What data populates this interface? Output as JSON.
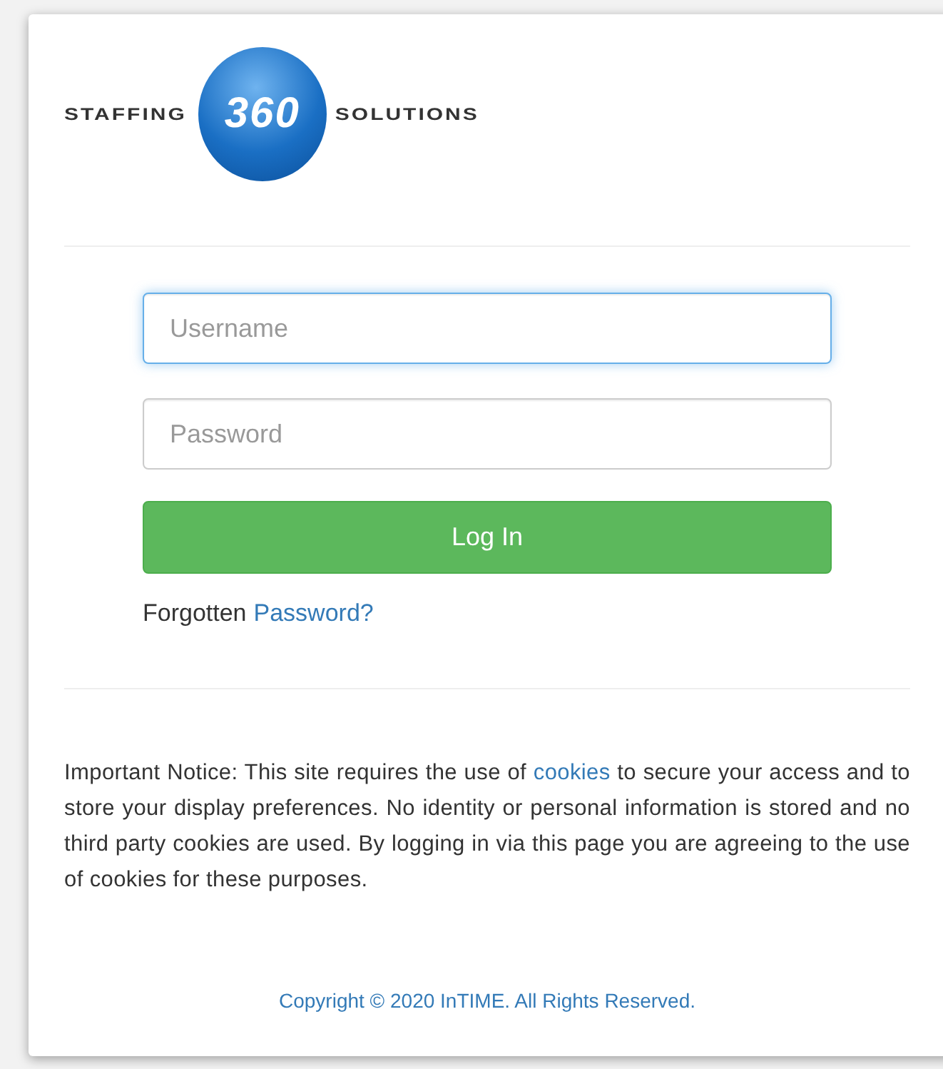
{
  "logo": {
    "left_text": "STAFFING",
    "badge_text": "360",
    "right_text": "SOLUTIONS"
  },
  "fields": [
    {
      "placeholder": "Username",
      "focused": true
    },
    {
      "placeholder": "Password",
      "focused": false
    }
  ],
  "login_button": "Log In",
  "forgot": {
    "text": "Forgotten",
    "link": "Password?"
  },
  "notice": {
    "before": "Important Notice: This site requires the use of",
    "link": "cookies",
    "after": "to secure your access and to store your display preferences. No identity or personal information is stored and no third party cookies are used. By logging in via this page you are agreeing to the use of cookies for these purposes."
  },
  "copyright": "Copyright © 2020 InTIME. All Rights Reserved."
}
